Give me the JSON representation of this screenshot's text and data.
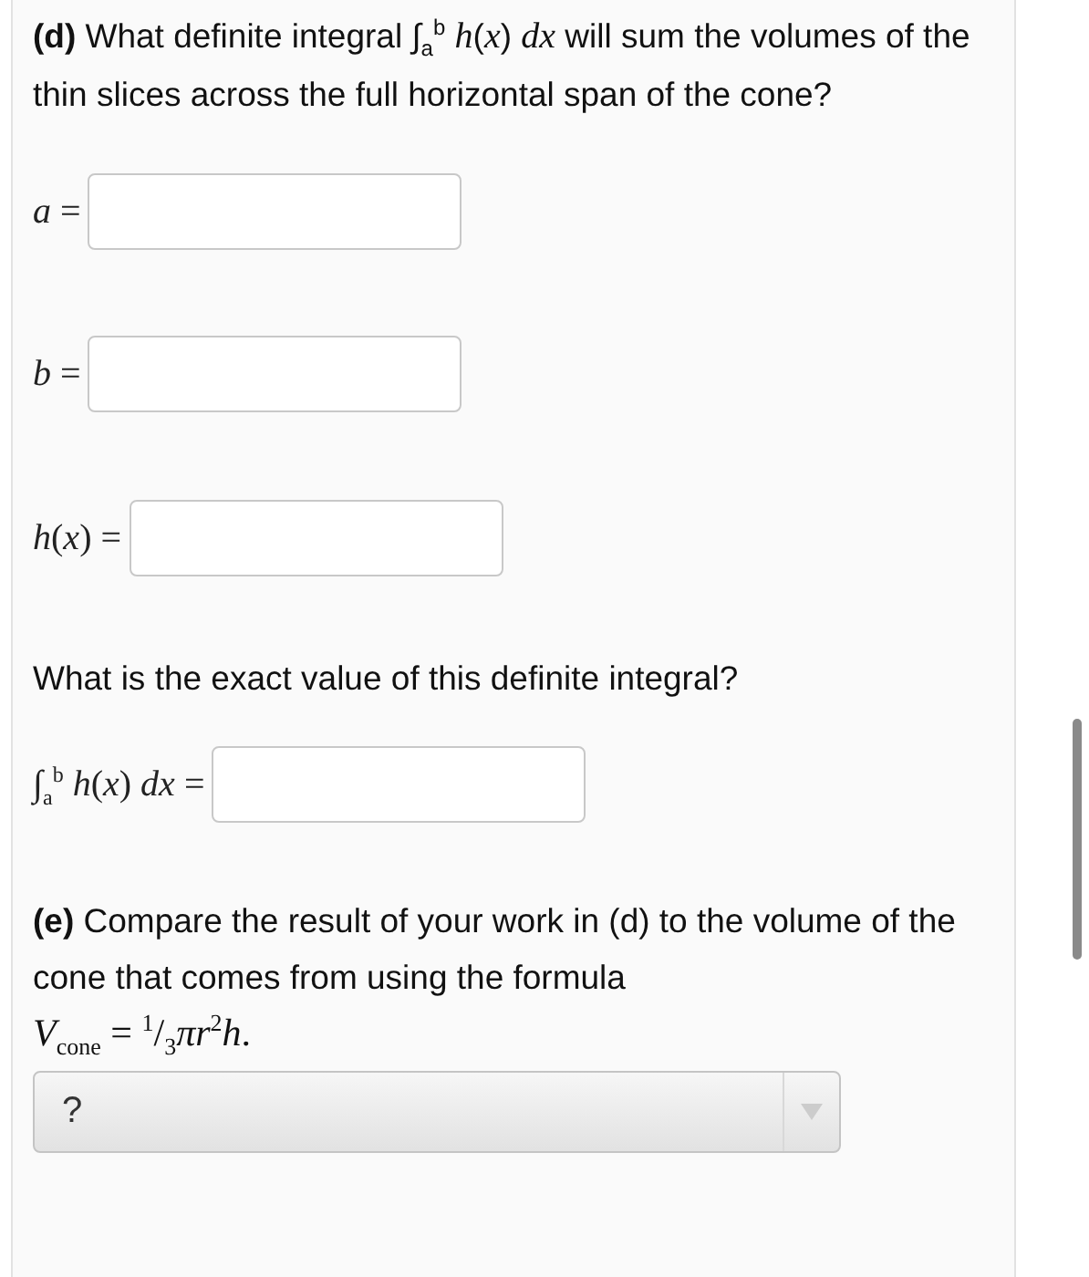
{
  "part_d": {
    "question": "**(d)** What definite integral ∫$_{a}$$^{b}$ *h*(*x*) *dx* will sum the volumes of the thin slices across the full horizontal span of the cone?",
    "fields": [
      {
        "label": "*a* ="
      },
      {
        "label": "*b* ="
      },
      {
        "label": "*h*(*x*) ="
      }
    ],
    "followup": "What is the exact value of this definite integral?",
    "integral_field": {
      "label": "∫$_{a}$$^{b}$ *h*(*x*) *dx* ="
    }
  },
  "part_e": {
    "question": "**(e)** Compare the result of your work in (d) to the volume of the cone that comes from using the formula",
    "formula": "*V*$_{cone}$ = $^{1}$/$_{3}$*πr*$^{2}$*h*.",
    "dropdown": {
      "value": "?"
    }
  }
}
